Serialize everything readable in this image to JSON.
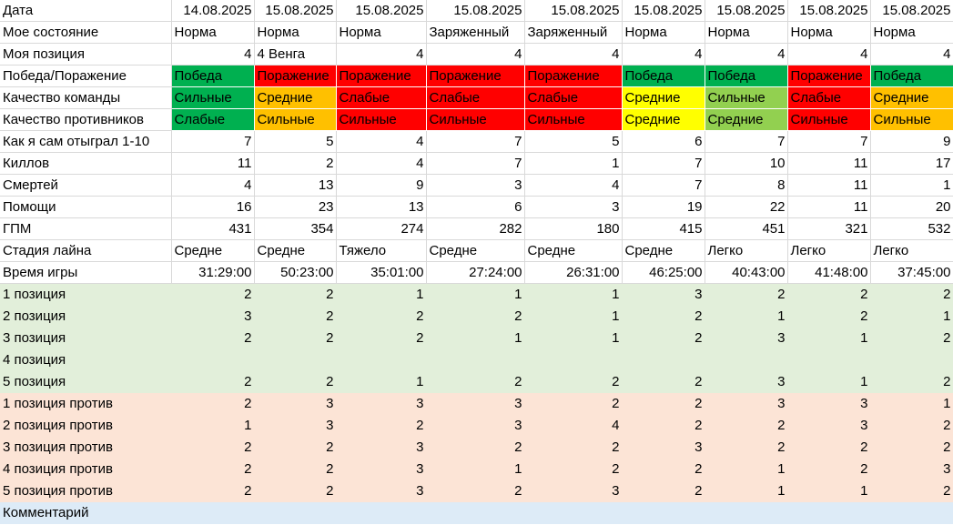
{
  "colors": {
    "win": "#00b050",
    "loss": "#ff0000",
    "strong": "#00b050",
    "medium_orange": "#ffc000",
    "weak": "#ff0000",
    "medium_yellow": "#ffff00",
    "strong_light": "#92d050",
    "positions_bg": "#e2efda",
    "positions_against_bg": "#fce4d6",
    "comment_bg": "#ddebf7"
  },
  "labels": {
    "date": "Дата",
    "state": "Мое состояние",
    "position": "Моя позиция",
    "result": "Победа/Поражение",
    "team_quality": "Качество команды",
    "enemy_quality": "Качество противников",
    "self_rating": "Как я сам отыграл 1-10",
    "kills": "Киллов",
    "deaths": "Смертей",
    "assists": "Помощи",
    "gpm": "ГПМ",
    "lane_stage": "Стадия лайна",
    "game_time": "Время игры",
    "pos1": "1 позиция",
    "pos2": "2 позиция",
    "pos3": "3 позиция",
    "pos4": "4 позиция",
    "pos5": "5 позиция",
    "pos1v": "1 позиция против",
    "pos2v": "2 позиция против",
    "pos3v": "3 позиция против",
    "pos4v": "4 позиция против",
    "pos5v": "5 позиция против",
    "comment": "Комментарий"
  },
  "rows": {
    "date": [
      "14.08.2025",
      "15.08.2025",
      "15.08.2025",
      "15.08.2025",
      "15.08.2025",
      "15.08.2025",
      "15.08.2025",
      "15.08.2025",
      "15.08.2025"
    ],
    "state": [
      "Норма",
      "Норма",
      "Норма",
      "Заряженный",
      "Заряженный",
      "Норма",
      "Норма",
      "Норма",
      "Норма"
    ],
    "position": [
      "4",
      "4 Венга",
      "4",
      "4",
      "4",
      "4",
      "4",
      "4",
      "4"
    ],
    "result": [
      "Победа",
      "Поражение",
      "Поражение",
      "Поражение",
      "Поражение",
      "Победа",
      "Победа",
      "Поражение",
      "Победа"
    ],
    "team_quality": [
      "Сильные",
      "Средние",
      "Слабые",
      "Слабые",
      "Слабые",
      "Средние",
      "Сильные",
      "Слабые",
      "Средние"
    ],
    "enemy_quality": [
      "Слабые",
      "Сильные",
      "Сильные",
      "Сильные",
      "Сильные",
      "Средние",
      "Средние",
      "Сильные",
      "Сильные"
    ],
    "self_rating": [
      "7",
      "5",
      "4",
      "7",
      "5",
      "6",
      "7",
      "7",
      "9"
    ],
    "kills": [
      "11",
      "2",
      "4",
      "7",
      "1",
      "7",
      "10",
      "11",
      "17"
    ],
    "deaths": [
      "4",
      "13",
      "9",
      "3",
      "4",
      "7",
      "8",
      "11",
      "1"
    ],
    "assists": [
      "16",
      "23",
      "13",
      "6",
      "3",
      "19",
      "22",
      "11",
      "20"
    ],
    "gpm": [
      "431",
      "354",
      "274",
      "282",
      "180",
      "415",
      "451",
      "321",
      "532"
    ],
    "lane_stage": [
      "Средне",
      "Средне",
      "Тяжело",
      "Средне",
      "Средне",
      "Средне",
      "Легко",
      "Легко",
      "Легко"
    ],
    "game_time": [
      "31:29:00",
      "50:23:00",
      "35:01:00",
      "27:24:00",
      "26:31:00",
      "46:25:00",
      "40:43:00",
      "41:48:00",
      "37:45:00"
    ],
    "pos1": [
      "2",
      "2",
      "1",
      "1",
      "1",
      "3",
      "2",
      "2",
      "2"
    ],
    "pos2": [
      "3",
      "2",
      "2",
      "2",
      "1",
      "2",
      "1",
      "2",
      "1"
    ],
    "pos3": [
      "2",
      "2",
      "2",
      "1",
      "1",
      "2",
      "3",
      "1",
      "2"
    ],
    "pos4": [
      "",
      "",
      "",
      "",
      "",
      "",
      "",
      "",
      ""
    ],
    "pos5": [
      "2",
      "2",
      "1",
      "2",
      "2",
      "2",
      "3",
      "1",
      "2"
    ],
    "pos1v": [
      "2",
      "3",
      "3",
      "3",
      "2",
      "2",
      "3",
      "3",
      "1"
    ],
    "pos2v": [
      "1",
      "3",
      "2",
      "3",
      "4",
      "2",
      "2",
      "3",
      "2"
    ],
    "pos3v": [
      "2",
      "2",
      "3",
      "2",
      "2",
      "3",
      "2",
      "2",
      "2"
    ],
    "pos4v": [
      "2",
      "2",
      "3",
      "1",
      "2",
      "2",
      "1",
      "2",
      "3"
    ],
    "pos5v": [
      "2",
      "2",
      "3",
      "2",
      "3",
      "2",
      "1",
      "1",
      "2"
    ]
  },
  "cell_colors": {
    "result": [
      "c-darkgreen",
      "c-red",
      "c-red",
      "c-red",
      "c-red",
      "c-darkgreen",
      "c-darkgreen",
      "c-red",
      "c-darkgreen"
    ],
    "team_quality": [
      "c-darkgreen",
      "c-orange",
      "c-red",
      "c-red",
      "c-red",
      "c-yellow",
      "c-lightgreen",
      "c-red",
      "c-orange"
    ],
    "enemy_quality": [
      "c-darkgreen",
      "c-orange",
      "c-red",
      "c-red",
      "c-red",
      "c-yellow",
      "c-lightgreen",
      "c-red",
      "c-orange"
    ]
  }
}
